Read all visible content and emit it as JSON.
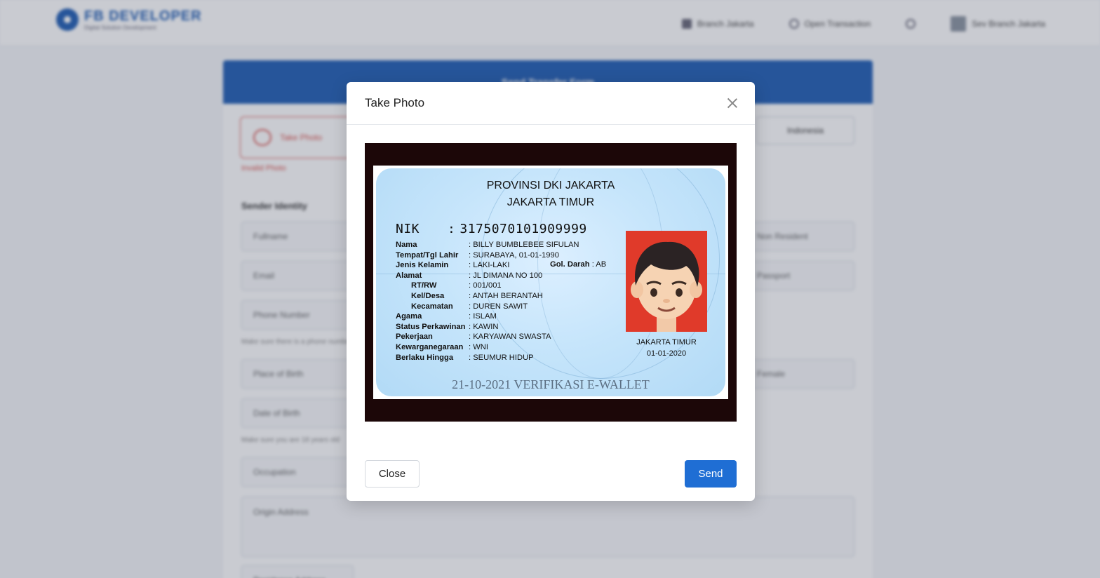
{
  "app": {
    "brand_name": "FB DEVELOPER",
    "brand_sub": "Digital Solution Development",
    "nav": {
      "branch": "Branch Jakarta",
      "open_transaction": "Open Transaction",
      "user": "Sev Branch Jakarta"
    }
  },
  "form": {
    "header_title": "Send Transfer Form",
    "take_photo_label": "Take Photo",
    "invalid_photo": "Invalid Photo",
    "country_value": "Indonesia",
    "sender_identity_title": "Sender Identity",
    "fields": {
      "fullname": "Fullname",
      "email": "Email",
      "phone": "Phone Number",
      "phone_hint": "Make sure there is a phone number",
      "place_of_birth": "Place of Birth",
      "date_of_birth": "Date of Birth",
      "dob_hint": "Make sure you are 18 years old",
      "occupation": "Occupation",
      "origin_address": "Origin Address",
      "residence_address": "Residence Address",
      "non_resident": "Non Resident",
      "passport": "Passport",
      "female": "Female"
    }
  },
  "modal": {
    "title": "Take Photo",
    "close_label": "Close",
    "send_label": "Send"
  },
  "id_card": {
    "province": "PROVINSI DKI JAKARTA",
    "city": "JAKARTA TIMUR",
    "nik_label": "NIK",
    "nik_value": "3175070101909999",
    "rows": [
      {
        "label": "Nama",
        "value": ": BILLY BUMBLEBEE SIFULAN"
      },
      {
        "label": "Tempat/Tgl Lahir",
        "value": ": SURABAYA, 01-01-1990"
      },
      {
        "label": "Jenis Kelamin",
        "value": ": LAKI-LAKI"
      },
      {
        "label": "Alamat",
        "value": ": JL DIMANA NO 100"
      },
      {
        "label": "RT/RW",
        "value": ": 001/001"
      },
      {
        "label": "Kel/Desa",
        "value": ": ANTAH BERANTAH"
      },
      {
        "label": "Kecamatan",
        "value": ": DUREN SAWIT"
      },
      {
        "label": "Agama",
        "value": ": ISLAM"
      },
      {
        "label": "Status Perkawinan",
        "value": ": KAWIN"
      },
      {
        "label": "Pekerjaan",
        "value": ": KARYAWAN SWASTA"
      },
      {
        "label": "Kewarganegaraan",
        "value": ": WNI"
      },
      {
        "label": "Berlaku Hingga",
        "value": ": SEUMUR HIDUP"
      }
    ],
    "blood_label": "Gol. Darah",
    "blood_value": ": AB",
    "issue_city": "JAKARTA TIMUR",
    "issue_date": "01-01-2020",
    "verification_text": "21-10-2021 VERIFIKASI E-WALLET"
  }
}
